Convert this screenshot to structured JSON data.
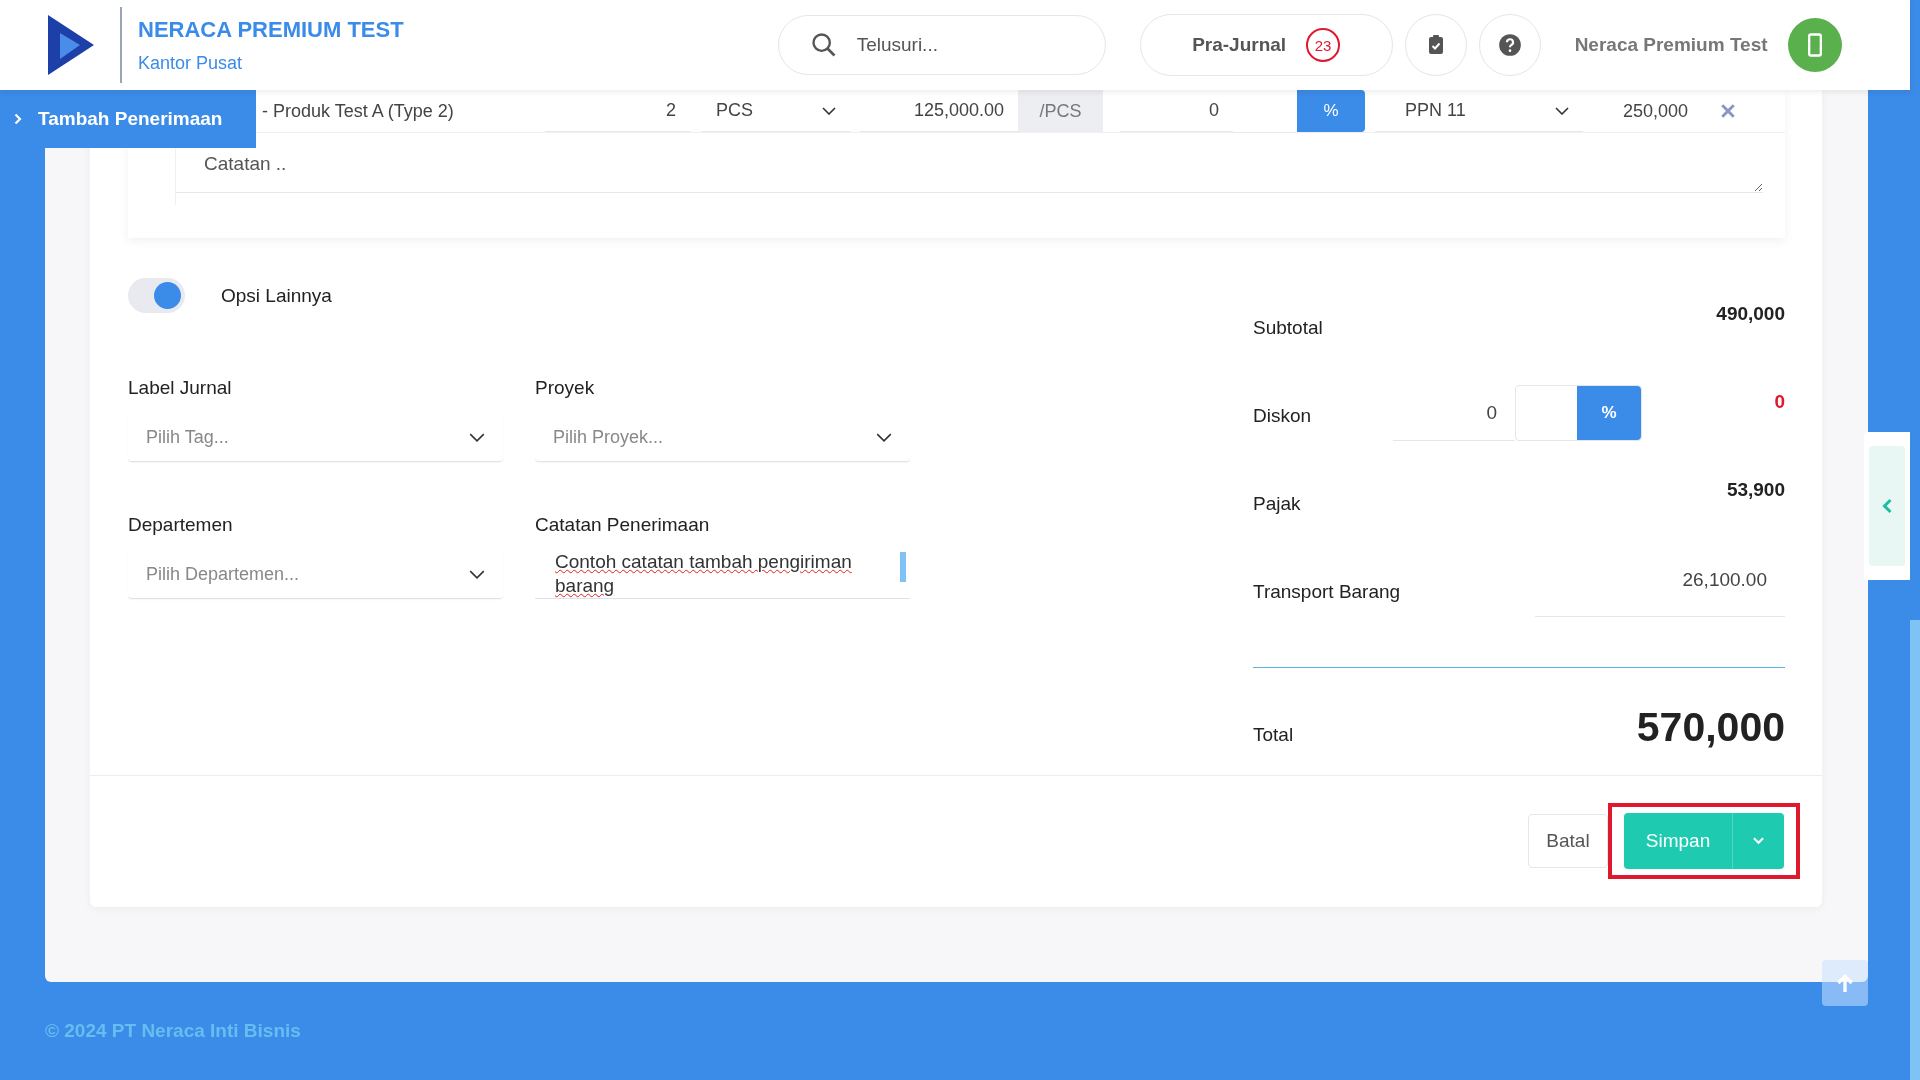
{
  "header": {
    "brand_title": "NERACA PREMIUM TEST",
    "brand_subtitle": "Kantor Pusat",
    "search": {
      "placeholder": "Telusuri..."
    },
    "pra_jurnal": {
      "label": "Pra-Jurnal",
      "count": "23"
    },
    "user_name": "Neraca Premium Test"
  },
  "breadcrumb": {
    "label": "Tambah Penerimaan"
  },
  "item_row": {
    "product": "- Produk Test A (Type 2)",
    "qty": "2",
    "unit": "PCS",
    "price": "125,000.00",
    "per_unit": "/PCS",
    "discount": "0",
    "discount_unit": "%",
    "tax": "PPN 11",
    "amount": "250,000",
    "note": {
      "placeholder": "Catatan .."
    }
  },
  "options": {
    "label": "Opsi Lainnya",
    "on": true
  },
  "fields": [
    {
      "label": "Label Jurnal",
      "kind": "select",
      "placeholder": "Pilih Tag..."
    },
    {
      "label": "Proyek",
      "kind": "select",
      "placeholder": "Pilih Proyek..."
    },
    {
      "label": "Departemen",
      "kind": "select",
      "placeholder": "Pilih Departemen..."
    },
    {
      "label": "Catatan Penerimaan",
      "kind": "textarea",
      "value": "Contoh catatan tambah pengiriman barang"
    }
  ],
  "totals": {
    "subtotal": {
      "label": "Subtotal",
      "value": "490,000"
    },
    "discount": {
      "label": "Diskon",
      "value": "0",
      "unit": "%",
      "amount": "0"
    },
    "tax": {
      "label": "Pajak",
      "value": "53,900"
    },
    "transport": {
      "label": "Transport Barang",
      "value": "26,100.00"
    },
    "total": {
      "label": "Total",
      "value": "570,000"
    }
  },
  "actions": {
    "cancel": "Batal",
    "save": "Simpan",
    "highlighted": true
  },
  "footer": {
    "copyright": "© 2024 PT Neraca Inti Bisnis"
  }
}
